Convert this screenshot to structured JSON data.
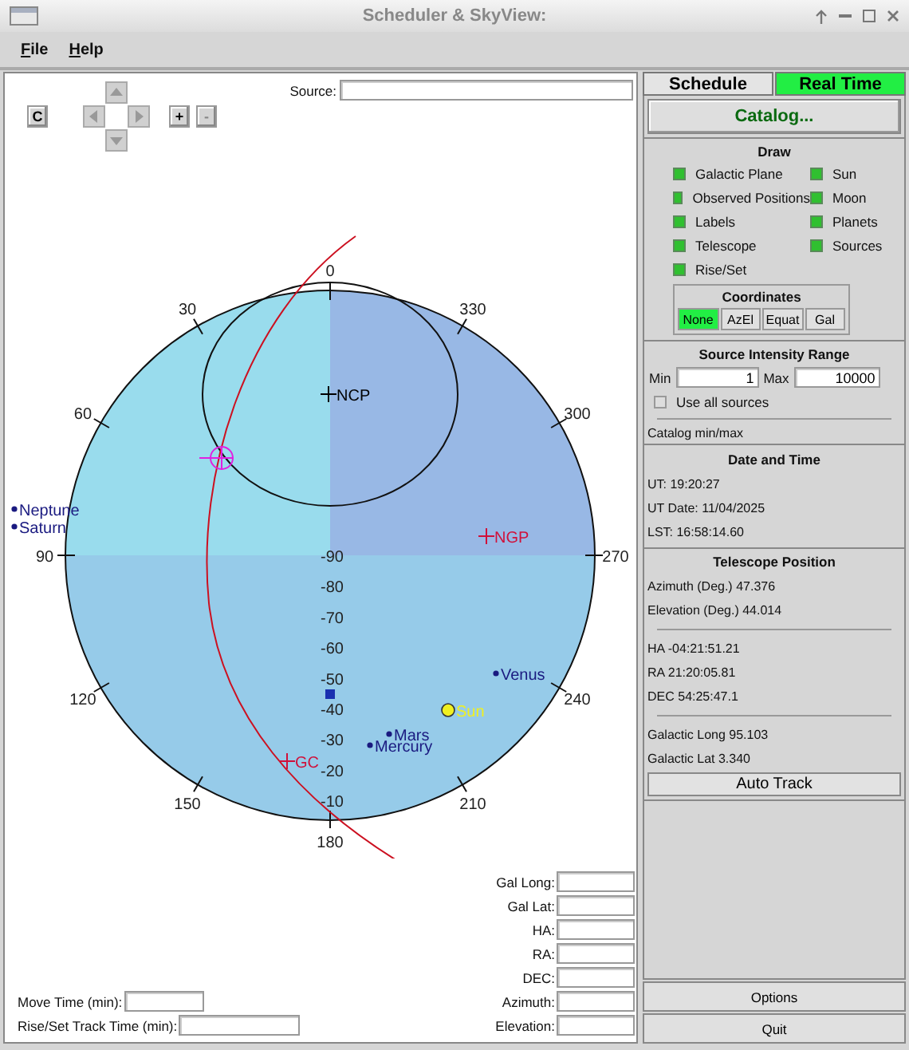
{
  "window": {
    "title": "Scheduler & SkyView:"
  },
  "menu": [
    "File",
    "Help"
  ],
  "sky_view": {
    "source_label": "Source:",
    "center_button": "C",
    "zoom_in_button": "+",
    "zoom_out_button": "-",
    "azimuth_labels": [
      "0",
      "30",
      "60",
      "90",
      "120",
      "150",
      "180",
      "210",
      "240",
      "270",
      "300",
      "330"
    ],
    "elevation_labels": [
      "-90",
      "-80",
      "-70",
      "-60",
      "-50",
      "-40",
      "-30",
      "-20",
      "-10"
    ],
    "markers": [
      {
        "label": "NCP",
        "kind": "cross",
        "color": "#000000"
      },
      {
        "label": "NGP",
        "kind": "cross",
        "color": "#d0103a"
      },
      {
        "label": "GC",
        "kind": "cross",
        "color": "#d0103a"
      },
      {
        "label": "Neptune",
        "kind": "planet",
        "color": "#1a1a80"
      },
      {
        "label": "Saturn",
        "kind": "planet",
        "color": "#1a1a80"
      },
      {
        "label": "Venus",
        "kind": "planet",
        "color": "#1a1a80"
      },
      {
        "label": "Sun",
        "kind": "sun",
        "color": "#f0f020"
      },
      {
        "label": "Mars",
        "kind": "planet",
        "color": "#1a1a80"
      },
      {
        "label": "Mercury",
        "kind": "planet",
        "color": "#1a1a80"
      }
    ]
  },
  "coordinate_fields": [
    "Gal Long:",
    "Gal Lat:",
    "HA:",
    "RA:",
    "DEC:",
    "Azimuth:",
    "Elevation:"
  ],
  "time_fields": [
    "Move Time (min):",
    "Rise/Set Track Time (min):"
  ],
  "tabs": [
    {
      "label": "Schedule",
      "selected": false
    },
    {
      "label": "Real Time",
      "selected": true
    }
  ],
  "catalog_button": "Catalog...",
  "draw": {
    "title": "Draw",
    "options": [
      {
        "label": "Galactic Plane",
        "checked": true
      },
      {
        "label": "Sun",
        "checked": true
      },
      {
        "label": "Observed Positions",
        "checked": true
      },
      {
        "label": "Moon",
        "checked": true
      },
      {
        "label": "Labels",
        "checked": true
      },
      {
        "label": "Planets",
        "checked": true
      },
      {
        "label": "Telescope",
        "checked": true
      },
      {
        "label": "Sources",
        "checked": true
      },
      {
        "label": "Rise/Set",
        "checked": true
      }
    ]
  },
  "coordinates": {
    "title": "Coordinates",
    "options": [
      {
        "label": "None",
        "selected": true
      },
      {
        "label": "AzEl",
        "selected": false
      },
      {
        "label": "Equat",
        "selected": false
      },
      {
        "label": "Gal",
        "selected": false
      }
    ]
  },
  "intensity": {
    "title": "Source Intensity Range",
    "min_label": "Min",
    "min": "1",
    "max_label": "Max",
    "max": "10000",
    "use_all": {
      "label": "Use all sources",
      "checked": false
    },
    "note": "Catalog min/max"
  },
  "date_time": {
    "title": "Date and Time",
    "lines": [
      "UT: 19:20:27",
      "UT Date: 11/04/2025",
      "LST: 16:58:14.60"
    ]
  },
  "telescope": {
    "title": "Telescope Position",
    "groups": [
      [
        "Azimuth (Deg.) 47.376",
        "Elevation (Deg.) 44.014"
      ],
      [
        "HA -04:21:51.21",
        "RA 21:20:05.81",
        "DEC 54:25:47.1"
      ],
      [
        "Galactic Long 95.103",
        "Galactic Lat 3.340"
      ]
    ]
  },
  "auto_track_button": "Auto Track",
  "bottom_buttons": [
    "Options",
    "Quit"
  ]
}
